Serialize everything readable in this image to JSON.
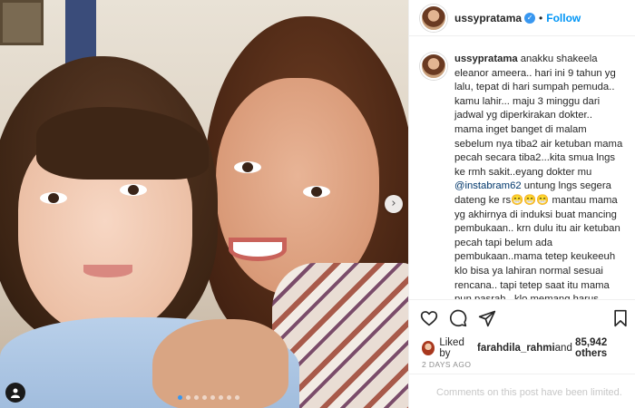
{
  "post": {
    "username": "ussypratama",
    "verified_glyph": "✓",
    "separator": "•",
    "follow_label": "Follow",
    "caption_username": "ussypratama",
    "caption_part1": "anakku shakeela eleanor ameera.. hari ini 9 tahun yg lalu, tepat di hari sumpah pemuda.. kamu lahir... maju 3 minggu dari jadwal yg diperkirakan dokter.. mama inget banget di malam sebelum nya tiba2 air ketuban mama pecah secara tiba2...kita smua lngs ke rmh sakit..eyang dokter mu ",
    "caption_mention": "@instabram62",
    "caption_part2": " untung lngs segera dateng ke rs😁😁😁 mantau mama yg akhirnya di induksi buat mancing pembukaan.. krn dulu itu air ketuban pecah tapi belum ada pembukaan..mama tetep keukeeuh klo bisa ya lahiran normal sesuai rencana.. tapi tetep saat itu mama pun pasrah.. klo memang harus oprasi pun ga masalah, krn buat mama lahiran normal atau oprasi ya sama aja.. yg penting kamu n mama sehat smua..",
    "likes_prefix": "Liked by ",
    "likes_user": "farahdila_rahmi",
    "likes_middle": " and ",
    "likes_count": "85,942 others",
    "timestamp": "2 DAYS AGO",
    "comments_limited": "Comments on this post have been limited.",
    "next_glyph": "›",
    "carousel_count": 8,
    "carousel_active_index": 0
  },
  "icons": {
    "heart": "heart-icon",
    "comment": "comment-icon",
    "share": "paper-plane-icon",
    "save": "bookmark-icon",
    "next": "chevron-right-icon",
    "user_tag": "user-tag-icon"
  },
  "colors": {
    "follow": "#0095f6",
    "verified": "#3897f0",
    "mention": "#00376b",
    "muted": "#8e8e8e"
  }
}
